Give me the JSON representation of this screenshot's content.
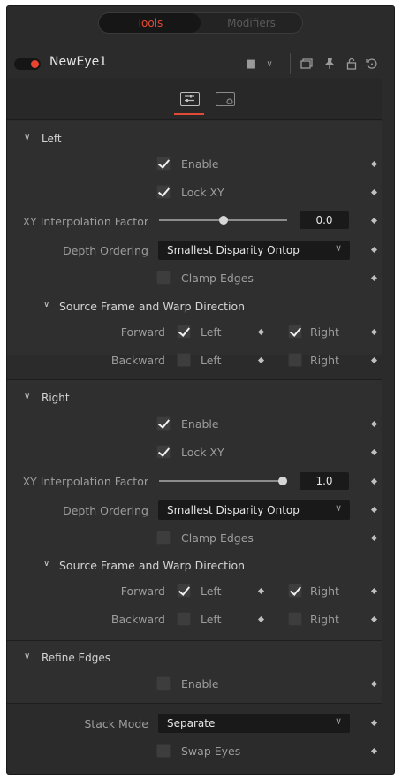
{
  "tabs": {
    "tools": "Tools",
    "modifiers": "Modifiers"
  },
  "header": {
    "node_name": "NewEye1"
  },
  "left": {
    "title": "Left",
    "enable": "Enable",
    "lock_xy": "Lock XY",
    "xy_label": "XY Interpolation Factor",
    "xy_value": "0.0",
    "xy_fraction": 0.5,
    "depth_label": "Depth Ordering",
    "depth_value": "Smallest Disparity Ontop",
    "clamp": "Clamp Edges",
    "sub_title": "Source Frame and Warp Direction",
    "forward": "Forward",
    "backward": "Backward",
    "left": "Left",
    "right": "Right"
  },
  "right": {
    "title": "Right",
    "enable": "Enable",
    "lock_xy": "Lock XY",
    "xy_label": "XY Interpolation Factor",
    "xy_value": "1.0",
    "xy_fraction": 1.0,
    "depth_label": "Depth Ordering",
    "depth_value": "Smallest Disparity Ontop",
    "clamp": "Clamp Edges",
    "sub_title": "Source Frame and Warp Direction",
    "forward": "Forward",
    "backward": "Backward",
    "left": "Left",
    "right": "Right"
  },
  "refine": {
    "title": "Refine Edges",
    "enable": "Enable"
  },
  "stack": {
    "label": "Stack Mode",
    "value": "Separate",
    "swap": "Swap Eyes"
  },
  "colors": {
    "accent": "#e14a36",
    "toggle_on": "#e8432f"
  }
}
